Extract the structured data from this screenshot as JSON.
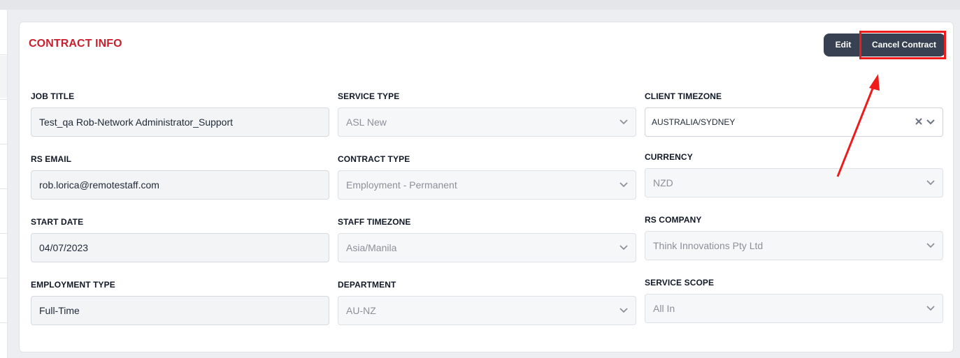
{
  "card": {
    "title": "CONTRACT INFO",
    "edit_label": "Edit",
    "cancel_label": "Cancel Contract"
  },
  "fields": {
    "job_title": {
      "label": "JOB TITLE",
      "value": "Test_qa Rob-Network Administrator_Support"
    },
    "rs_email": {
      "label": "RS EMAIL",
      "value": "rob.lorica@remotestaff.com"
    },
    "start_date": {
      "label": "START DATE",
      "value": "04/07/2023"
    },
    "employment_type": {
      "label": "EMPLOYMENT TYPE",
      "value": "Full-Time"
    },
    "service_type": {
      "label": "SERVICE TYPE",
      "value": "ASL New"
    },
    "contract_type": {
      "label": "CONTRACT TYPE",
      "value": "Employment - Permanent"
    },
    "staff_timezone": {
      "label": "STAFF TIMEZONE",
      "value": "Asia/Manila"
    },
    "department": {
      "label": "DEPARTMENT",
      "value": "AU-NZ"
    },
    "client_timezone": {
      "label": "CLIENT TIMEZONE",
      "value": "AUSTRALIA/SYDNEY"
    },
    "currency": {
      "label": "CURRENCY",
      "value": "NZD"
    },
    "rs_company": {
      "label": "RS COMPANY",
      "value": "Think Innovations Pty Ltd"
    },
    "service_scope": {
      "label": "SERVICE SCOPE",
      "value": "All In"
    }
  },
  "icons": {
    "chevron": "chevron-down-icon",
    "clear": "clear-x-icon"
  },
  "colors": {
    "title": "#c8202f",
    "button": "#374151",
    "highlight": "#ef1b1b"
  }
}
